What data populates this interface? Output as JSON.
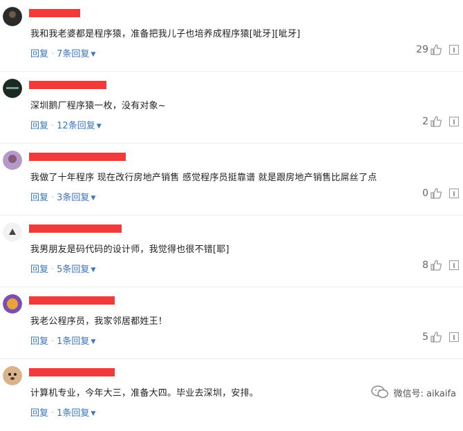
{
  "comments": [
    {
      "text": "我和我老婆都是程序猿，准备把我儿子也培养成程序猿[呲牙][呲牙]",
      "reply": "回复",
      "replies": "7条回复",
      "likes": "29",
      "avatar": "dark-round-avatar"
    },
    {
      "text": "深圳鹅厂程序猿一枚，没有对象~",
      "reply": "回复",
      "replies": "12条回复",
      "likes": "2",
      "avatar": "dark-logo-avatar"
    },
    {
      "text": "我做了十年程序 现在改行房地产销售 感觉程序员挺靠谱 就是跟房地产销售比屌丝了点",
      "reply": "回复",
      "replies": "3条回复",
      "likes": "0",
      "avatar": "purple-portrait-avatar"
    },
    {
      "text": "我男朋友是码代码的设计师，我觉得也很不错[耶]",
      "reply": "回复",
      "replies": "5条回复",
      "likes": "8",
      "avatar": "white-cartoon-avatar"
    },
    {
      "text": "我老公程序员，我家邻居都姓王！",
      "reply": "回复",
      "replies": "1条回复",
      "likes": "5",
      "avatar": "purple-cartoon-avatar"
    },
    {
      "text": "计算机专业，今年大三，准备大四。毕业去深圳，安排。",
      "reply": "回复",
      "replies": "1条回复",
      "likes": "",
      "avatar": "dog-avatar"
    }
  ],
  "watermark": {
    "text": "微信号: aikaifa"
  },
  "colors": {
    "link": "#3a74c0",
    "redact": "#f23a3a"
  }
}
